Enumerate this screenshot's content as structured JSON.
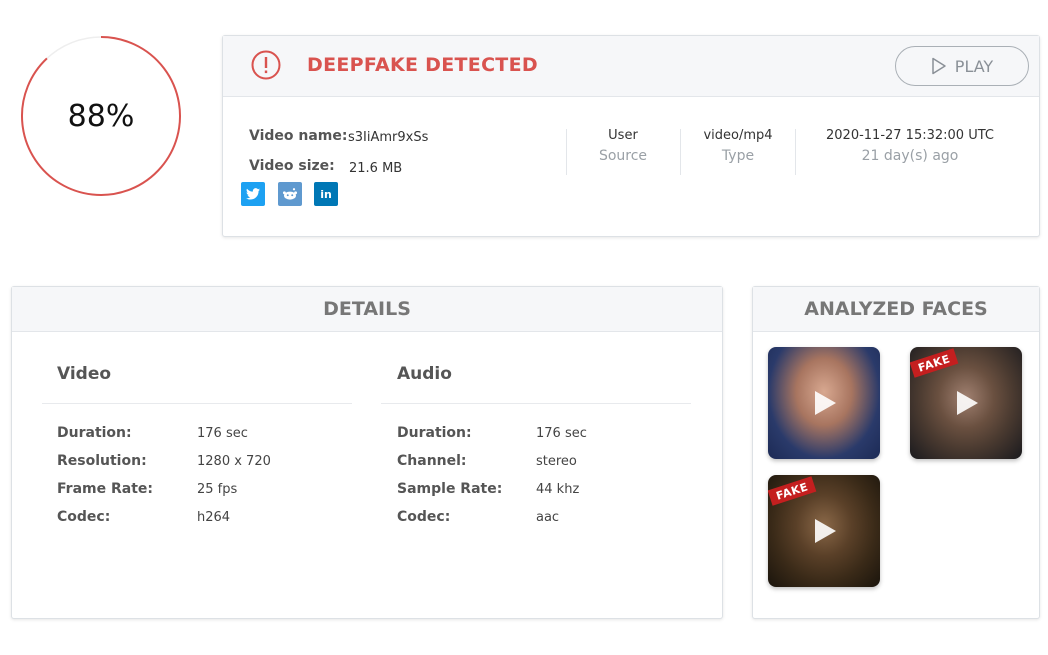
{
  "score": {
    "value": "88%",
    "fraction": 0.88,
    "color": "#d9534f"
  },
  "alert": {
    "title": "DEEPFAKE DETECTED",
    "icon": "exclamation-circle-icon"
  },
  "play_button": {
    "label": "PLAY",
    "icon": "play-outline-icon"
  },
  "video_info": {
    "name_label": "Video name:",
    "name_value": "s3IiAmr9xSs",
    "size_label": "Video size:",
    "size_value": "21.6 MB"
  },
  "social": [
    {
      "name": "twitter",
      "icon": "twitter-icon",
      "color": "#1da1f2"
    },
    {
      "name": "reddit",
      "icon": "reddit-icon",
      "color": "#5f99cf"
    },
    {
      "name": "linkedin",
      "icon": "linkedin-icon",
      "color": "#0077b5",
      "text": "in"
    }
  ],
  "info_columns": [
    {
      "top": "User",
      "bottom": "Source"
    },
    {
      "top": "video/mp4",
      "bottom": "Type"
    },
    {
      "top": "2020-11-27 15:32:00 UTC",
      "bottom": "21 day(s) ago"
    }
  ],
  "details": {
    "title": "DETAILS",
    "video": {
      "title": "Video",
      "rows": [
        {
          "label": "Duration:",
          "value": "176 sec"
        },
        {
          "label": "Resolution:",
          "value": "1280 x 720"
        },
        {
          "label": "Frame Rate:",
          "value": "25 fps"
        },
        {
          "label": "Codec:",
          "value": "h264"
        }
      ]
    },
    "audio": {
      "title": "Audio",
      "rows": [
        {
          "label": "Duration:",
          "value": "176 sec"
        },
        {
          "label": "Channel:",
          "value": "stereo"
        },
        {
          "label": "Sample Rate:",
          "value": "44 khz"
        },
        {
          "label": "Codec:",
          "value": "aac"
        }
      ]
    }
  },
  "faces": {
    "title": "ANALYZED FACES",
    "items": [
      {
        "fake": false,
        "badge": ""
      },
      {
        "fake": true,
        "badge": "FAKE"
      },
      {
        "fake": true,
        "badge": "FAKE"
      }
    ]
  }
}
